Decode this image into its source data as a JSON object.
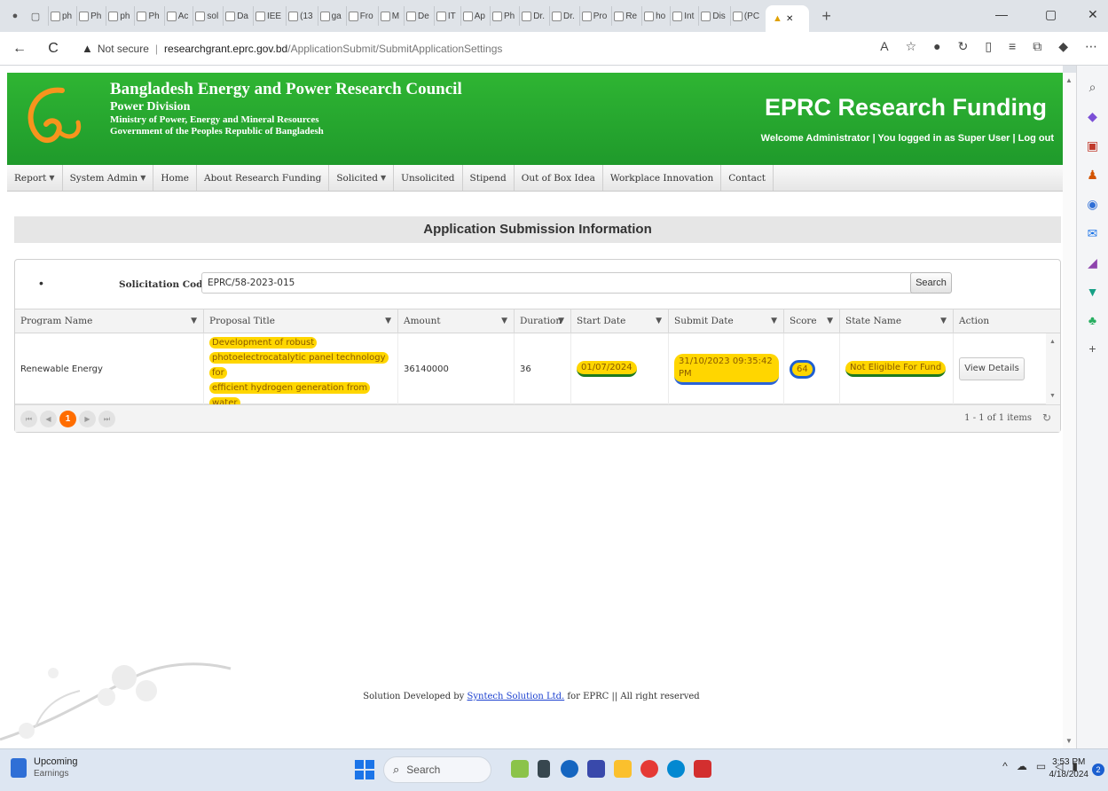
{
  "browser": {
    "tabs_mini": [
      "ph",
      "Ph",
      "ph",
      "Ph",
      "Ac",
      "sol",
      "Da",
      "IEE",
      "(13",
      "ga",
      "Fro",
      "M",
      "De",
      "IT",
      "Ap",
      "Ph",
      "Dr.",
      "Dr.",
      "Pro",
      "Re",
      "ho",
      "Int",
      "Dis",
      "(PC"
    ],
    "new_tab": "+",
    "minimize": "—",
    "restore": "▢",
    "close": "✕",
    "back": "←",
    "refresh": "C",
    "security_label": "Not secure",
    "url_host": "researchgrant.eprc.gov.bd",
    "url_path": "/ApplicationSubmit/SubmitApplicationSettings"
  },
  "header": {
    "org_name": "Bangladesh Energy and Power Research Council",
    "division": "Power Division",
    "ministry": "Ministry of Power, Energy and Mineral Resources",
    "government": "Government of the Peoples Republic of Bangladesh",
    "site_title": "EPRC Research Funding",
    "welcome": "Welcome Administrator",
    "logged_in_as": "You logged in as Super User",
    "logout": "Log out",
    "sep": "|"
  },
  "menu": {
    "items": [
      {
        "label": "Report",
        "dropdown": true
      },
      {
        "label": "System Admin",
        "dropdown": true
      },
      {
        "label": "Home",
        "dropdown": false
      },
      {
        "label": "About Research Funding",
        "dropdown": false
      },
      {
        "label": "Solicited",
        "dropdown": true
      },
      {
        "label": "Unsolicited",
        "dropdown": false
      },
      {
        "label": "Stipend",
        "dropdown": false
      },
      {
        "label": "Out of Box Idea",
        "dropdown": false
      },
      {
        "label": "Workplace Innovation",
        "dropdown": false
      },
      {
        "label": "Contact",
        "dropdown": false
      }
    ]
  },
  "main": {
    "title": "Application Submission Information",
    "filter": {
      "bullet": "•",
      "label": "Solicitation Code",
      "required": "*:",
      "value": "EPRC/58-2023-015",
      "search_button": "Search"
    },
    "columns": [
      "Program Name",
      "Proposal Title",
      "Amount",
      "Duration",
      "Start Date",
      "Submit Date",
      "Score",
      "State Name",
      "Action"
    ],
    "rows": [
      {
        "program_name": "Renewable Energy",
        "title_line1": "Development of robust",
        "title_line2": "photoelectrocatalytic panel technology for",
        "title_line3": "efficient hydrogen generation from water",
        "amount": "36140000",
        "duration": "36",
        "start_date": "01/07/2024",
        "submit_date_line1": "31/10/2023 09:35:42",
        "submit_date_line2": "PM",
        "score": "64",
        "state_name": "Not Eligible For Fund",
        "action": "View Details"
      }
    ],
    "pager": {
      "first": "⏮",
      "prev": "◀",
      "current": "1",
      "next": "▶",
      "last": "⏭",
      "info": "1 - 1 of 1 items"
    }
  },
  "footer": {
    "prefix": "Solution Developed by",
    "company": "Syntech Solution Ltd.",
    "suffix": "for EPRC || All right reserved"
  },
  "taskbar": {
    "weather_line1": "Upcoming",
    "weather_line2": "Earnings",
    "search": "Search",
    "time": "3:53 PM",
    "date": "4/18/2024"
  },
  "colors": {
    "banner_green": "#2fb533",
    "highlight_yellow": "#ffd600",
    "pager_orange": "#ff6d00",
    "link_blue": "#1a3fcf"
  }
}
